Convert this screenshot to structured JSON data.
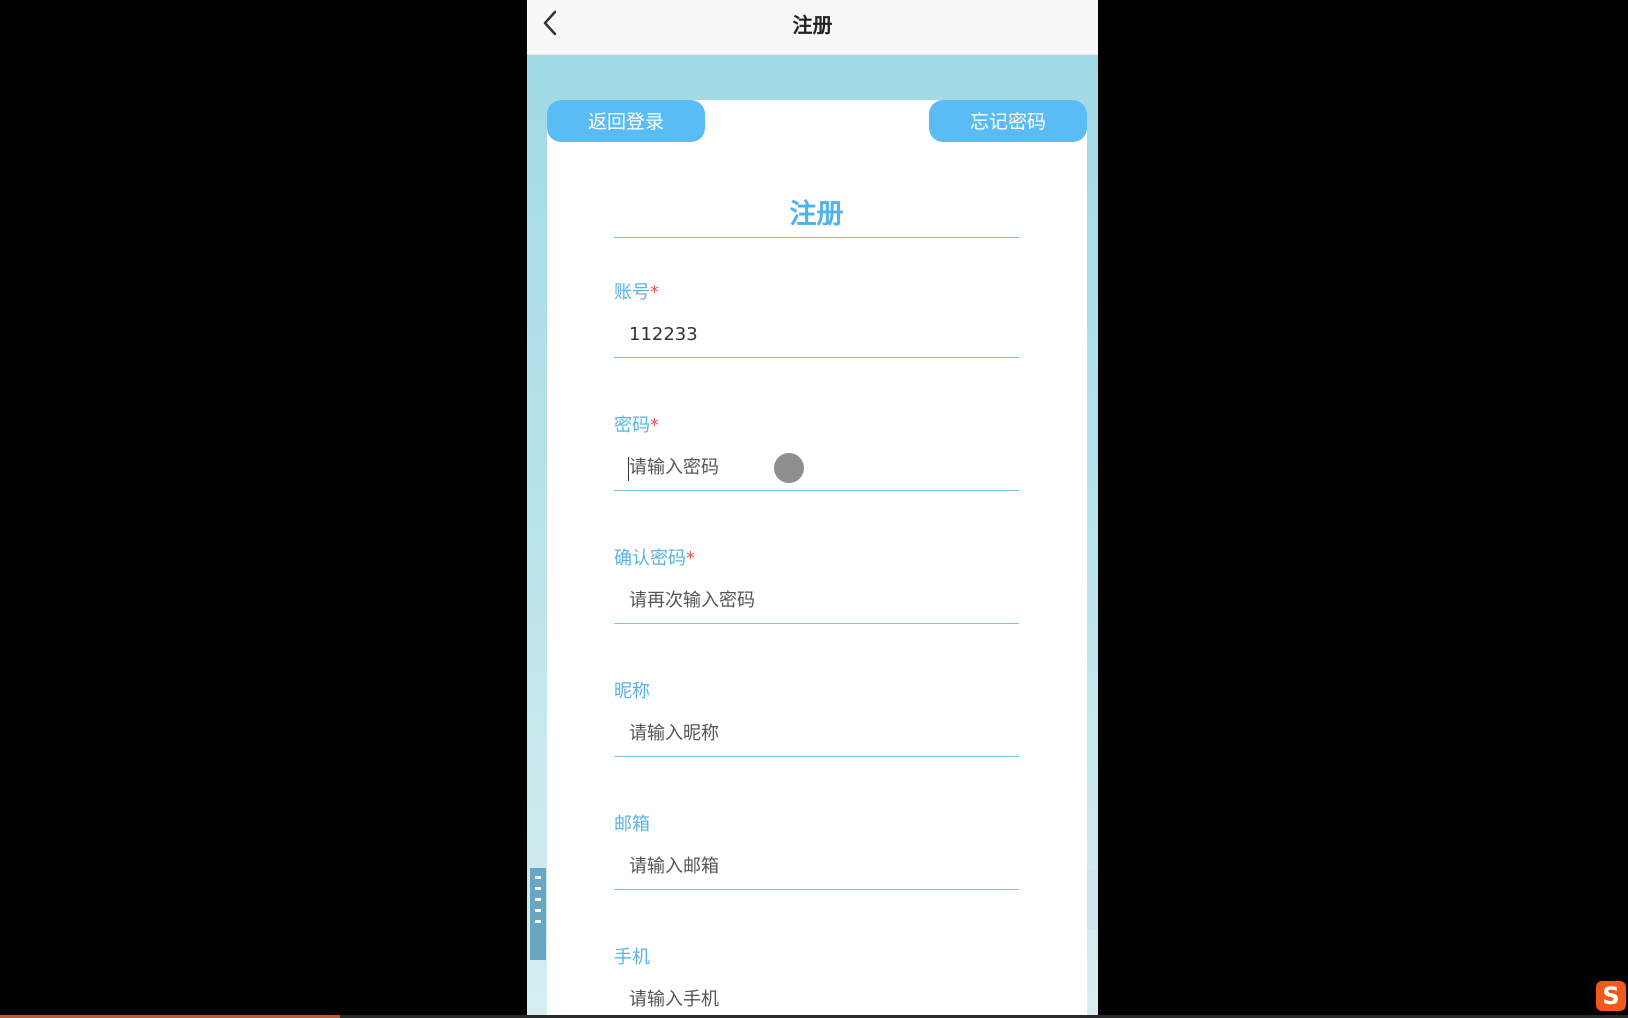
{
  "navbar": {
    "title": "注册",
    "back_icon": "chevron-left-icon"
  },
  "card": {
    "back_to_login_label": "返回登录",
    "forgot_password_label": "忘记密码",
    "form_title": "注册"
  },
  "fields": [
    {
      "label": "账号",
      "required": "*",
      "value": "112233",
      "placeholder": ""
    },
    {
      "label": "密码",
      "required": "*",
      "value": "",
      "placeholder": "请输入密码"
    },
    {
      "label": "确认密码",
      "required": "*",
      "value": "",
      "placeholder": "请再次输入密码"
    },
    {
      "label": "昵称",
      "required": "",
      "value": "",
      "placeholder": "请输入昵称"
    },
    {
      "label": "邮箱",
      "required": "",
      "value": "",
      "placeholder": "请输入邮箱"
    },
    {
      "label": "手机",
      "required": "",
      "value": "",
      "placeholder": "请输入手机"
    }
  ],
  "taskbar": {
    "ime_icon": "sogou-ime-icon",
    "ime_letter": "S"
  },
  "colors": {
    "accent": "#5bbcf5",
    "title_blue": "#4fb2ec",
    "required_red": "#e05a5a"
  }
}
